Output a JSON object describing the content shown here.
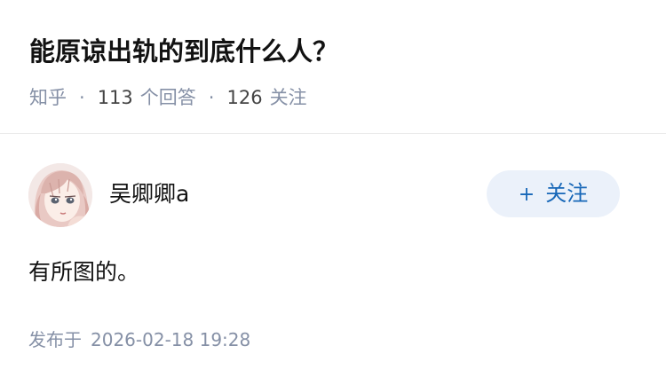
{
  "question": {
    "title": "能原谅出轨的到底什么人？",
    "source": "知乎",
    "separator": "·",
    "answer_count": "113",
    "answer_label": "个回答",
    "follower_count": "126",
    "follower_label": "关注"
  },
  "answer": {
    "author_name": "吴卿卿a",
    "avatar_icon": "avatar-anime-girl",
    "follow_button": {
      "icon": "plus-icon",
      "plus": "+",
      "label": "关注"
    },
    "content": "有所图的。",
    "published_label": "发布于",
    "published_date": "2026-02-18 19:28"
  },
  "colors": {
    "title": "#121212",
    "meta": "#8590a6",
    "follow_bg": "#ebf1fa",
    "follow_text": "#1767b8",
    "divider": "#ebebeb"
  }
}
